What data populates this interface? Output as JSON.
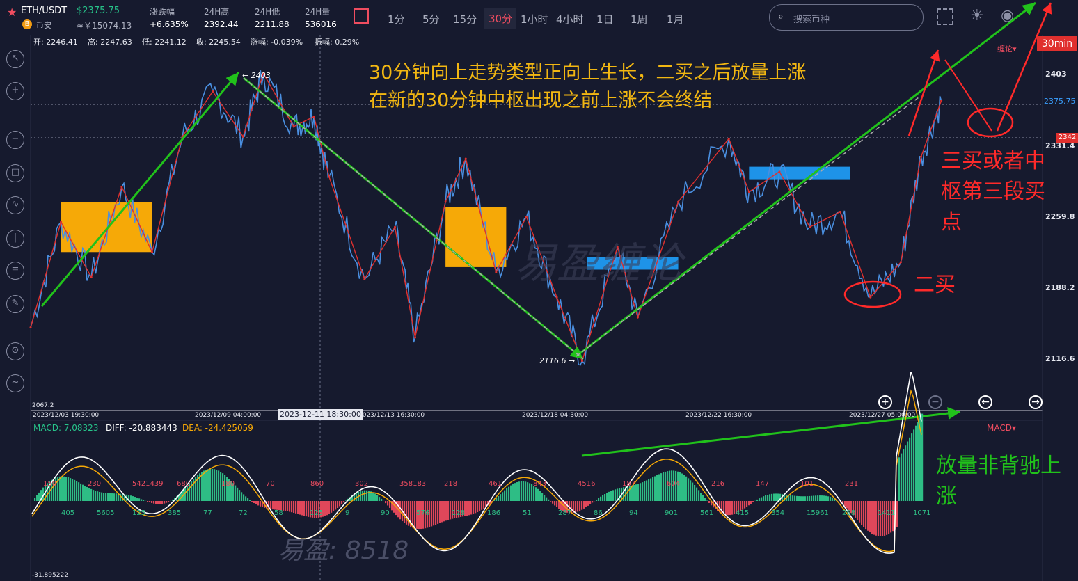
{
  "header": {
    "symbol": "ETH/USDT",
    "price": "$2375.75",
    "exchange": "币安",
    "cny_price": "≈￥15074.13",
    "stats": [
      {
        "label": "涨跌幅",
        "value": "+6.635%"
      },
      {
        "label": "24H高",
        "value": "2392.44"
      },
      {
        "label": "24H低",
        "value": "2211.88"
      },
      {
        "label": "24H量",
        "value": "536016"
      }
    ],
    "intervals": [
      "1分",
      "5分",
      "15分",
      "30分",
      "1小时",
      "4小时",
      "1日",
      "1周",
      "1月"
    ],
    "active_interval": "30分",
    "search_placeholder": "搜索币种",
    "accent_color": "#ef4d60"
  },
  "ohlc": {
    "open": "开: 2246.41",
    "high": "高: 2247.63",
    "low": "低: 2241.12",
    "close": "收: 2245.54",
    "change": "涨幅: -0.039%",
    "amplitude": "振幅: 0.29%"
  },
  "badges": {
    "timeframe": "30min",
    "indicator_menu": "缠论▾",
    "macd_menu": "MACD▾",
    "price_tag": "2342"
  },
  "crosshair_time": "2023-12-11 18:30:00",
  "annotations": {
    "line1": "30分钟向上走势类型正向上生长，二买之后放量上涨",
    "line2": "在新的30分钟中枢出现之前上涨不会终结",
    "third_buy": "三买或者中枢第三段买点",
    "second_buy": "二买",
    "macd_note": "放量非背驰上涨"
  },
  "macd": {
    "macd_label": "MACD: 7.08323",
    "diff_label": "DIFF: -20.883443",
    "dea_label": "DEA: -24.425059",
    "min_label": "-31.895222",
    "histogram_labels_top": [
      "150",
      "230",
      "5421439",
      "680",
      "180",
      "70",
      "860",
      "302",
      "358183",
      "218",
      "461",
      "843",
      "4516",
      "187",
      "604",
      "216",
      "147",
      "101",
      "231"
    ],
    "histogram_labels_bottom": [
      "405",
      "5605",
      "125",
      "385",
      "77",
      "72",
      "58",
      "125",
      "9",
      "90",
      "576",
      "128",
      "186",
      "51",
      "287",
      "86",
      "94",
      "901",
      "561",
      "415",
      "354",
      "15961",
      "298",
      "1411",
      "1071"
    ]
  },
  "watermark": "易盈: 8518",
  "watermark_main": "易盈缠论",
  "chart_data": {
    "type": "line",
    "title": "",
    "xlabel": "",
    "ylabel": "",
    "ylim": [
      2067.2,
      2440
    ],
    "y_ticks": [
      2403,
      2375.75,
      2331.4,
      2259.8,
      2188.2,
      2116.6
    ],
    "y_tick_labels": [
      "2403",
      "2375.75",
      "2331.4",
      "2259.8",
      "2188.2",
      "2116.6",
      "2067.2"
    ],
    "x_tick_labels": [
      "2023/12/03 19:30:00",
      "2023/12/09 04:00:00",
      "2023/12/13 16:30:00",
      "2023/12/18 04:30:00",
      "2023/12/22 16:30:00",
      "2023/12/27 05:00:00"
    ],
    "extreme_labels": [
      "← 2403",
      "2116.6 →"
    ],
    "price_series": [
      {
        "x": 0.0,
        "y": 2150
      },
      {
        "x": 0.03,
        "y": 2255
      },
      {
        "x": 0.06,
        "y": 2200
      },
      {
        "x": 0.09,
        "y": 2290
      },
      {
        "x": 0.12,
        "y": 2225
      },
      {
        "x": 0.15,
        "y": 2340
      },
      {
        "x": 0.18,
        "y": 2385
      },
      {
        "x": 0.21,
        "y": 2340
      },
      {
        "x": 0.23,
        "y": 2403
      },
      {
        "x": 0.26,
        "y": 2350
      },
      {
        "x": 0.28,
        "y": 2360
      },
      {
        "x": 0.295,
        "y": 2300
      },
      {
        "x": 0.33,
        "y": 2198
      },
      {
        "x": 0.36,
        "y": 2250
      },
      {
        "x": 0.38,
        "y": 2140
      },
      {
        "x": 0.41,
        "y": 2275
      },
      {
        "x": 0.43,
        "y": 2318
      },
      {
        "x": 0.46,
        "y": 2205
      },
      {
        "x": 0.49,
        "y": 2260
      },
      {
        "x": 0.52,
        "y": 2180
      },
      {
        "x": 0.545,
        "y": 2116.6
      },
      {
        "x": 0.58,
        "y": 2230
      },
      {
        "x": 0.6,
        "y": 2160
      },
      {
        "x": 0.64,
        "y": 2275
      },
      {
        "x": 0.69,
        "y": 2338
      },
      {
        "x": 0.71,
        "y": 2285
      },
      {
        "x": 0.74,
        "y": 2305
      },
      {
        "x": 0.77,
        "y": 2250
      },
      {
        "x": 0.8,
        "y": 2265
      },
      {
        "x": 0.83,
        "y": 2180
      },
      {
        "x": 0.86,
        "y": 2215
      },
      {
        "x": 0.88,
        "y": 2320
      },
      {
        "x": 0.9,
        "y": 2375.75
      }
    ],
    "pivot_zones": [
      {
        "x1": 0.03,
        "x2": 0.12,
        "y1": 2225,
        "y2": 2275,
        "color": "#f6a907"
      },
      {
        "x1": 0.41,
        "x2": 0.47,
        "y1": 2210,
        "y2": 2270,
        "color": "#f6a907"
      },
      {
        "x1": 0.71,
        "x2": 0.81,
        "y1": 2305,
        "y2": 2310,
        "color": "#1e93e8"
      },
      {
        "x1": 0.55,
        "x2": 0.64,
        "y1": 2210,
        "y2": 2220,
        "color": "#1e93e8"
      }
    ]
  }
}
